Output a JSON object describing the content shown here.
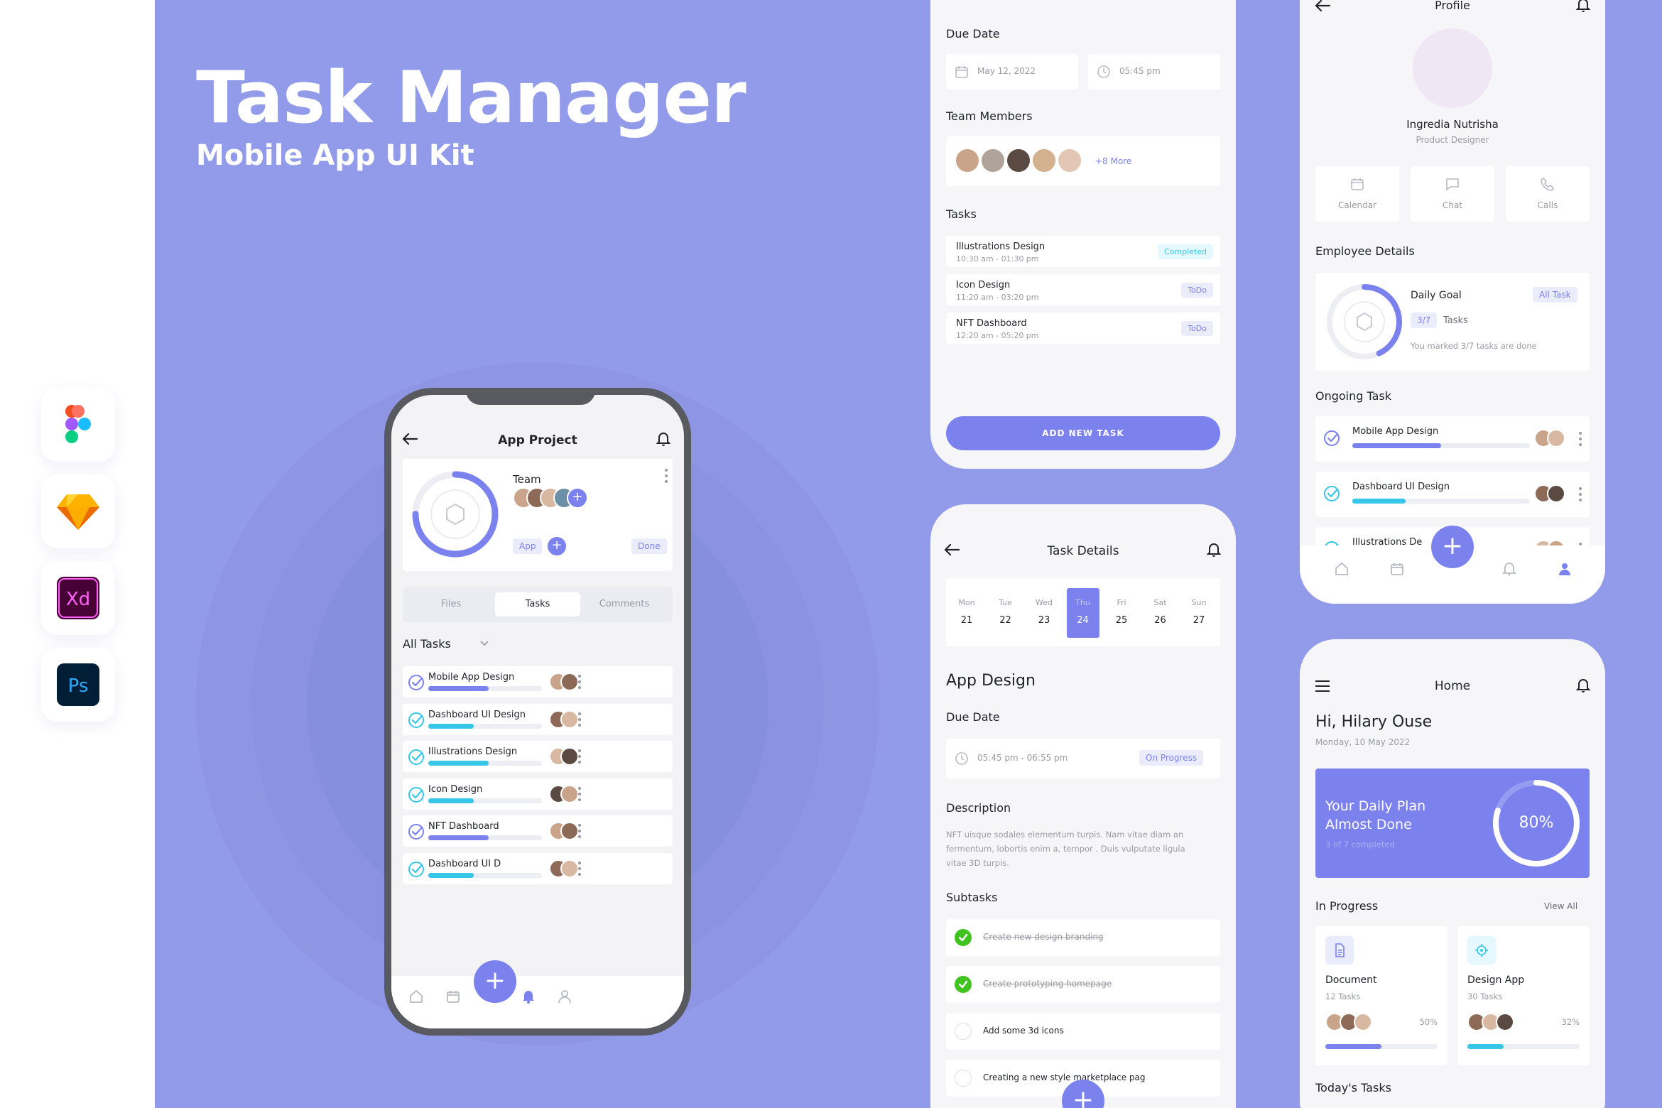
{
  "hero": {
    "title": "Task Manager",
    "subtitle": "Mobile App UI Kit"
  },
  "tools": [
    "figma-icon",
    "sketch-icon",
    "xd-icon",
    "photoshop-icon"
  ],
  "colors": {
    "background": "#929be9",
    "accent": "#7b82ee",
    "cyan": "#38c6e8",
    "green": "#41c31f",
    "white": "#ffffff"
  },
  "app_project": {
    "title": "App Project",
    "team_label": "Team",
    "progress": 0.75,
    "tag": "App",
    "status": "Done",
    "tabs": [
      "Files",
      "Tasks",
      "Comments"
    ],
    "active_tab": "Tasks",
    "filter": "All Tasks",
    "tasks": [
      {
        "name": "Mobile App Design",
        "progress": 0.53,
        "color": "#7b82ee"
      },
      {
        "name": "Dashboard UI Design",
        "progress": 0.4,
        "color": "#38c6e8"
      },
      {
        "name": "Illustrations Design",
        "progress": 0.53,
        "color": "#38c6e8"
      },
      {
        "name": "Icon Design",
        "progress": 0.4,
        "color": "#38c6e8"
      },
      {
        "name": "NFT Dashboard",
        "progress": 0.53,
        "color": "#7b82ee"
      },
      {
        "name": "Dashboard UI D",
        "progress": 0.4,
        "color": "#38c6e8"
      }
    ]
  },
  "create_task": {
    "due_date_label": "Due Date",
    "date": "May 12, 2022",
    "time": "05:45 pm",
    "team_members_label": "Team Members",
    "more": "+8 More",
    "tasks_label": "Tasks",
    "tasks": [
      {
        "name": "Illustrations Design",
        "time": "10:30 am - 01:30 pm",
        "status": "Completed"
      },
      {
        "name": "Icon Design",
        "time": "11:20 am - 03:20 pm",
        "status": "ToDo"
      },
      {
        "name": "NFT Dashboard",
        "time": "12:20 am - 05:20 pm",
        "status": "ToDo"
      }
    ],
    "button": "ADD NEW TASK"
  },
  "task_details": {
    "title": "Task Details",
    "days": [
      {
        "day": "Mon",
        "date": "21"
      },
      {
        "day": "Tue",
        "date": "22"
      },
      {
        "day": "Wed",
        "date": "23"
      },
      {
        "day": "Thu",
        "date": "24"
      },
      {
        "day": "Fri",
        "date": "25"
      },
      {
        "day": "Sat",
        "date": "26"
      },
      {
        "day": "Sun",
        "date": "27"
      }
    ],
    "selected_day": "Thu",
    "project_name": "App Design",
    "due_date_label": "Due Date",
    "due_time": "05:45 pm - 06:55 pm",
    "status": "On Progress",
    "description_label": "Description",
    "description_lines": [
      "NFT uisque sodales elementum turpis. Nam vitae diam an",
      "fermentum, lobortis enim a, tempor . Duis vulputate ligula",
      "vitae 3D turpis."
    ],
    "subtasks_label": "Subtasks",
    "subtasks": [
      {
        "text": "Create new design branding",
        "done": true
      },
      {
        "text": "Create prototyping homepage",
        "done": true
      },
      {
        "text": "Add some 3d icons",
        "done": false
      },
      {
        "text": "Creating a new style marketplace pag",
        "done": false
      }
    ]
  },
  "profile": {
    "title": "Profile",
    "name": "Ingredia Nutrisha",
    "role": "Product Designer",
    "actions": [
      {
        "label": "Calendar",
        "icon": "calendar-icon"
      },
      {
        "label": "Chat",
        "icon": "chat-icon"
      },
      {
        "label": "Calls",
        "icon": "phone-icon"
      }
    ],
    "employee_details_label": "Employee Details",
    "daily_goal_label": "Daily Goal",
    "goal_count": "3/7",
    "goal_unit": "Tasks",
    "goal_note": "You marked 3/7 tasks are done",
    "goal_progress": 0.43,
    "all_task": "All Task",
    "ongoing_label": "Ongoing Task",
    "ongoing": [
      {
        "name": "Mobile App Design",
        "progress": 0.5,
        "color": "#7b82ee"
      },
      {
        "name": "Dashboard UI Design",
        "progress": 0.3,
        "color": "#38c6e8"
      },
      {
        "name": "Illustrations De",
        "progress": 0.3,
        "color": "#38c6e8"
      }
    ]
  },
  "home": {
    "title": "Home",
    "greeting": "Hi, Hilary Ouse",
    "date": "Monday, 10 May 2022",
    "plan_line1": "Your Daily Plan",
    "plan_line2": "Almost Done",
    "plan_sub": "3 of 7 completed",
    "plan_percent": "80%",
    "plan_progress": 0.8,
    "in_progress_label": "In Progress",
    "view_all": "View All",
    "projects": [
      {
        "name": "Document",
        "tasks": "12 Tasks",
        "percent": "50%",
        "progress": 0.5,
        "color": "#7b82ee"
      },
      {
        "name": "Design App",
        "tasks": "30 Tasks",
        "percent": "32%",
        "progress": 0.32,
        "color": "#38c6e8"
      }
    ],
    "today_label": "Today's Tasks"
  }
}
